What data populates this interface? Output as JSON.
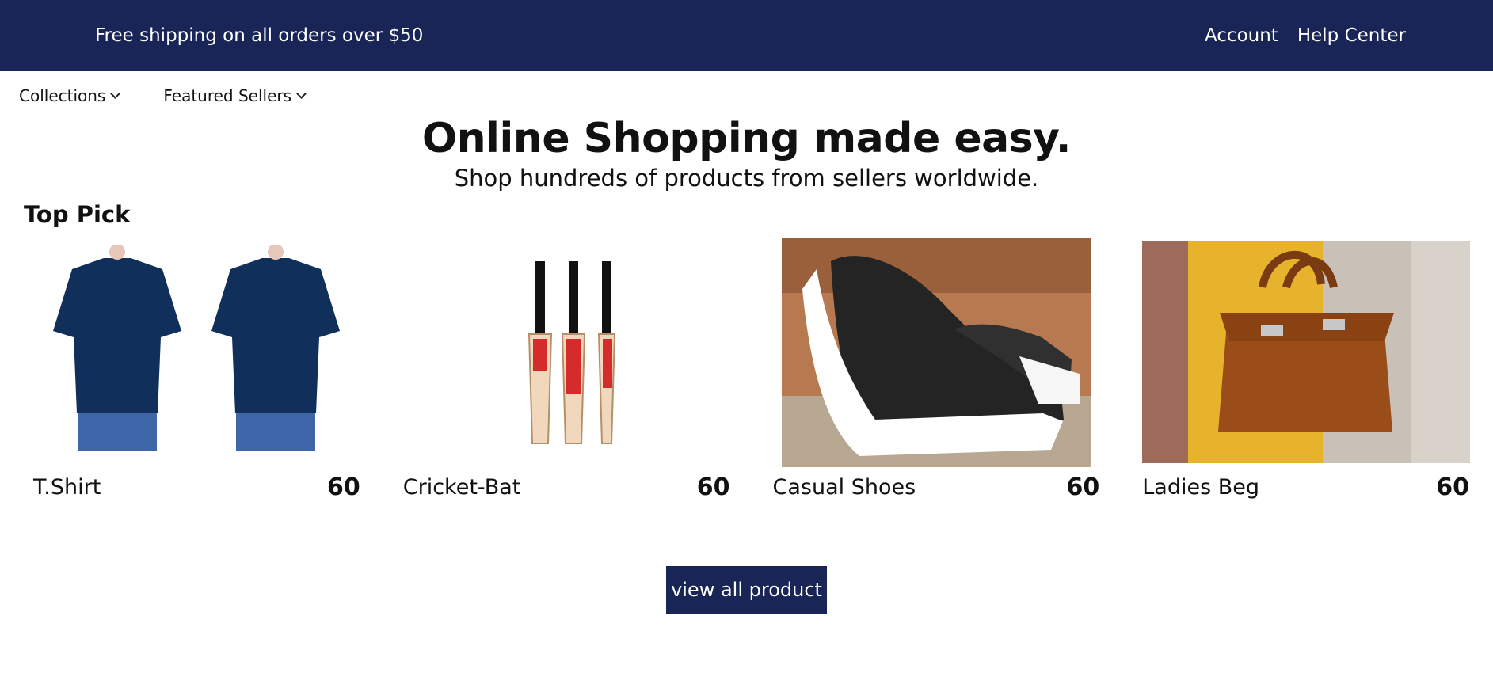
{
  "topbar": {
    "promo": "Free shipping on all orders over $50",
    "links": [
      "Account",
      "Help Center"
    ]
  },
  "nav": {
    "items": [
      "Collections",
      "Featured Sellers"
    ]
  },
  "hero": {
    "title": "Online Shopping made easy.",
    "subtitle": "Shop hundreds of products from sellers worldwide."
  },
  "section": {
    "title": "Top Pick"
  },
  "products": [
    {
      "name": "T.Shirt",
      "price": "60"
    },
    {
      "name": "Cricket-Bat",
      "price": "60"
    },
    {
      "name": "Casual Shoes",
      "price": "60"
    },
    {
      "name": "Ladies Beg",
      "price": "60"
    }
  ],
  "cta": {
    "label": "view all product"
  },
  "colors": {
    "navy": "#192557",
    "white": "#ffffff",
    "text": "#111111",
    "mustard": "#e7b22c"
  }
}
